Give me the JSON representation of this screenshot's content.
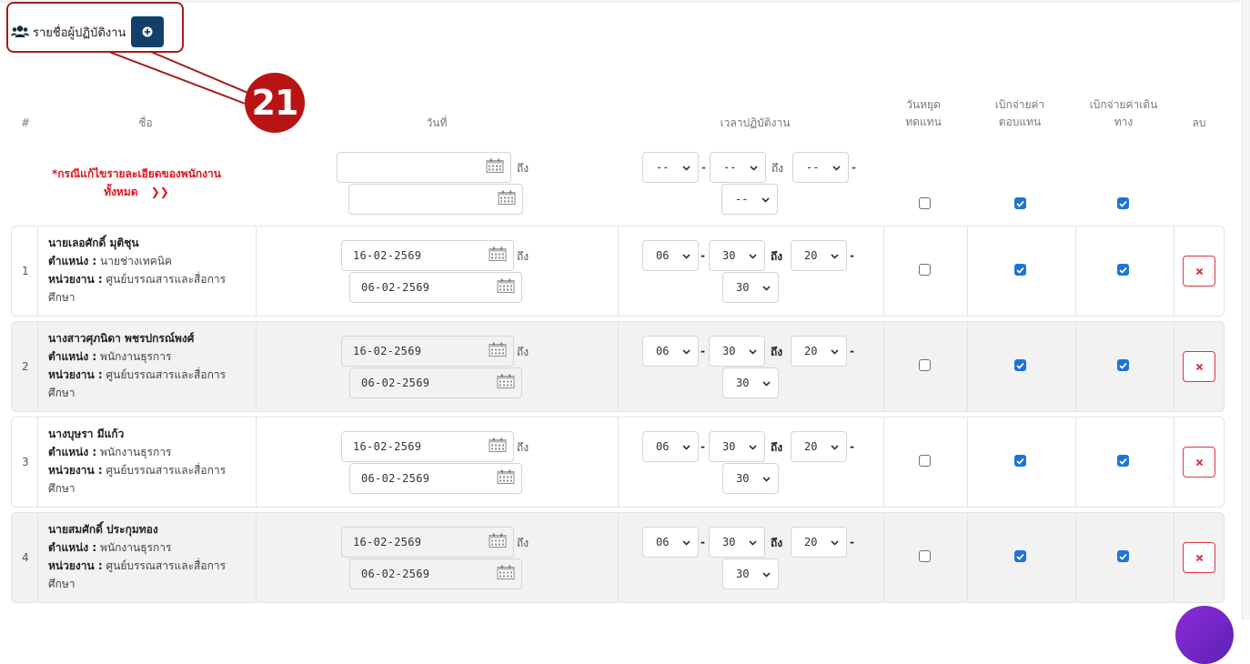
{
  "section": {
    "title": "รายชื่อผู้ปฏิบัติงาน",
    "title_icon": "users-icon",
    "add_icon": "plus-circle-icon"
  },
  "callout": {
    "number": "21"
  },
  "headers": {
    "num": "#",
    "name": "ชื่อ",
    "date": "วันที่",
    "time": "เวลาปฏิบัติงาน",
    "holiday_l1": "วันหยุด",
    "holiday_l2": "ทดแทน",
    "comp_l1": "เบิกจ่ายค่า",
    "comp_l2": "ตอบแทน",
    "travel_l1": "เบิกจ่ายค่าเดิน",
    "travel_l2": "ทาง",
    "delete": "ลบ"
  },
  "bulk": {
    "note_line1": "*กรณีแก้ไขรายละเอียดของพนักงาน",
    "note_line2": "ทั้งหมด",
    "note_arrow": "❯❯",
    "date_from": "",
    "date_to": "",
    "to_label": "ถึง",
    "time_start_hour": "--",
    "time_start_min": "--",
    "time_end_hour": "--",
    "time_end_min": "--",
    "holiday_checked": false,
    "comp_checked": true,
    "travel_checked": true
  },
  "field_labels": {
    "position": "ตำแหน่ง :",
    "unit": "หน่วยงาน :"
  },
  "rows": [
    {
      "num": "1",
      "name": "นายเลอศักดิ์ มุติชุน",
      "position": "นายช่างเทคนิค",
      "unit_line1": "ศูนย์บรรณสารและสื่อการ",
      "unit_line2": "ศึกษา",
      "date_from": "16-02-2569",
      "date_to": "06-02-2569",
      "to_label": "ถึง",
      "start_hour": "06",
      "start_min": "30",
      "end_hour": "20",
      "end_min": "30",
      "holiday": false,
      "comp": true,
      "travel": true
    },
    {
      "num": "2",
      "name": "นางสาวศุภนิดา พชรปกรณ์พงศ์",
      "position": "พนักงานธุรการ",
      "unit_line1": "ศูนย์บรรณสารและสื่อการ",
      "unit_line2": "ศึกษา",
      "date_from": "16-02-2569",
      "date_to": "06-02-2569",
      "to_label": "ถึง",
      "start_hour": "06",
      "start_min": "30",
      "end_hour": "20",
      "end_min": "30",
      "holiday": false,
      "comp": true,
      "travel": true
    },
    {
      "num": "3",
      "name": "นางบุษรา มีแก้ว",
      "position": "พนักงานธุรการ",
      "unit_line1": "ศูนย์บรรณสารและสื่อการ",
      "unit_line2": "ศึกษา",
      "date_from": "16-02-2569",
      "date_to": "06-02-2569",
      "to_label": "ถึง",
      "start_hour": "06",
      "start_min": "30",
      "end_hour": "20",
      "end_min": "30",
      "holiday": false,
      "comp": true,
      "travel": true
    },
    {
      "num": "4",
      "name": "นายสมศักดิ์ ประกุมทอง",
      "position": "พนักงานธุรการ",
      "unit_line1": "ศูนย์บรรณสารและสื่อการ",
      "unit_line2": "ศึกษา",
      "date_from": "16-02-2569",
      "date_to": "06-02-2569",
      "to_label": "ถึง",
      "start_hour": "06",
      "start_min": "30",
      "end_hour": "20",
      "end_min": "30",
      "holiday": false,
      "comp": true,
      "travel": true
    }
  ],
  "colors": {
    "accent": "#12406a",
    "danger": "#dc3545",
    "callout": "#b81414",
    "checkbox": "#1f73d6",
    "note": "#e3121b"
  }
}
